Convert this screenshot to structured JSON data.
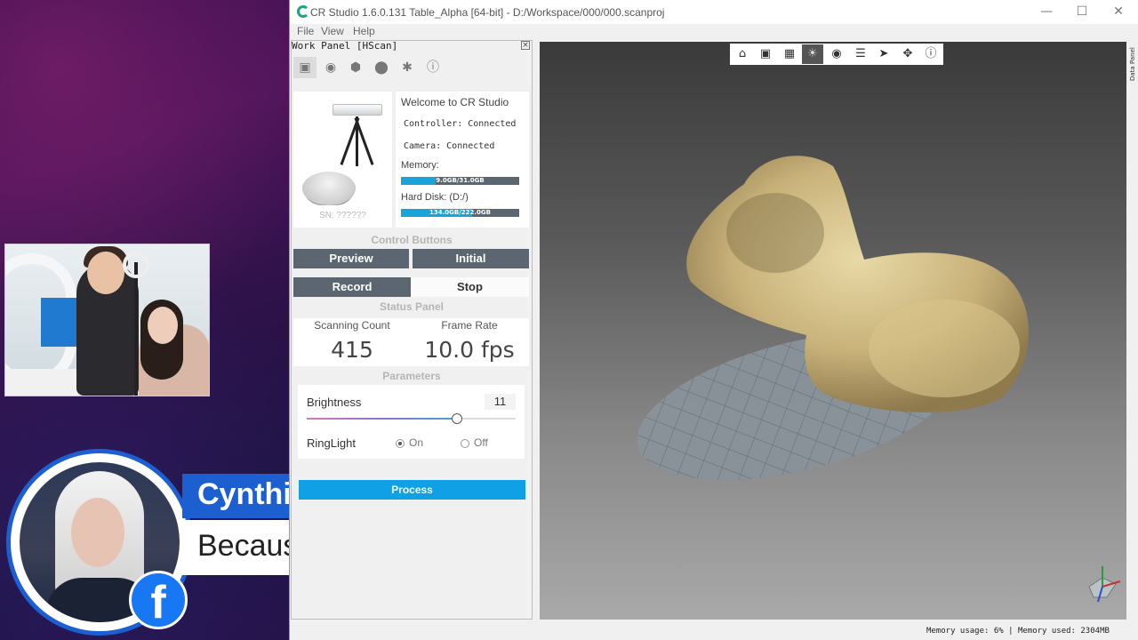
{
  "stream": {
    "guest_name": "Cynthi",
    "guest_subtitle": "Becaus",
    "social_badge": "f"
  },
  "window": {
    "title": "CR Studio 1.6.0.131 Table_Alpha [64-bit] - D:/Workspace/000/000.scanproj",
    "minimize_icon": "minimize-icon",
    "maximize_icon": "maximize-icon",
    "close_icon": "close-icon"
  },
  "menu": [
    "File",
    "View",
    "Help"
  ],
  "work_panel": {
    "title": "Work Panel [HScan]",
    "tool_icons": [
      "cube-icon",
      "eye-icon",
      "mesh-icon",
      "sphere-icon",
      "puzzle-icon",
      "info-icon"
    ],
    "sn": "SN: ??????",
    "welcome": "Welcome to CR Studio",
    "controller": "Controller: Connected",
    "camera": "Camera: Connected",
    "memory_label": "Memory:",
    "memory_text": "9.0GB/31.0GB",
    "memory_fraction": 0.29,
    "disk_label": "Hard Disk: (D:/)",
    "disk_text": "134.0GB/222.0GB",
    "disk_fraction": 0.6
  },
  "control_buttons": {
    "heading": "Control Buttons",
    "preview": "Preview",
    "initial": "Initial",
    "record": "Record",
    "stop": "Stop"
  },
  "status_panel": {
    "heading": "Status Panel",
    "scanning_count_label": "Scanning Count",
    "scanning_count": "415",
    "frame_rate_label": "Frame Rate",
    "frame_rate": "10.0 fps"
  },
  "parameters": {
    "heading": "Parameters",
    "brightness_label": "Brightness",
    "brightness_value": "11",
    "brightness_fraction": 0.72,
    "ringlight_label": "RingLight",
    "on_label": "On",
    "off_label": "Off",
    "ringlight_selected": "On"
  },
  "process_label": "Process",
  "viewport": {
    "toolbar_icons": [
      "home-icon",
      "fit-view-icon",
      "texture-icon",
      "light-icon",
      "eye-icon",
      "layers-icon",
      "select-cursor-icon",
      "move-icon",
      "info-icon"
    ],
    "selected_tool": "light-icon",
    "data_panel_tab": "Data Panel"
  },
  "statusbar": {
    "memory_usage": "Memory usage: 6%  |  Memory used: 2304MB"
  },
  "colors": {
    "accent": "#0fa0e6",
    "button_dark": "#5b6670",
    "brand_blue": "#1b5fd1",
    "facebook": "#1877f2"
  }
}
